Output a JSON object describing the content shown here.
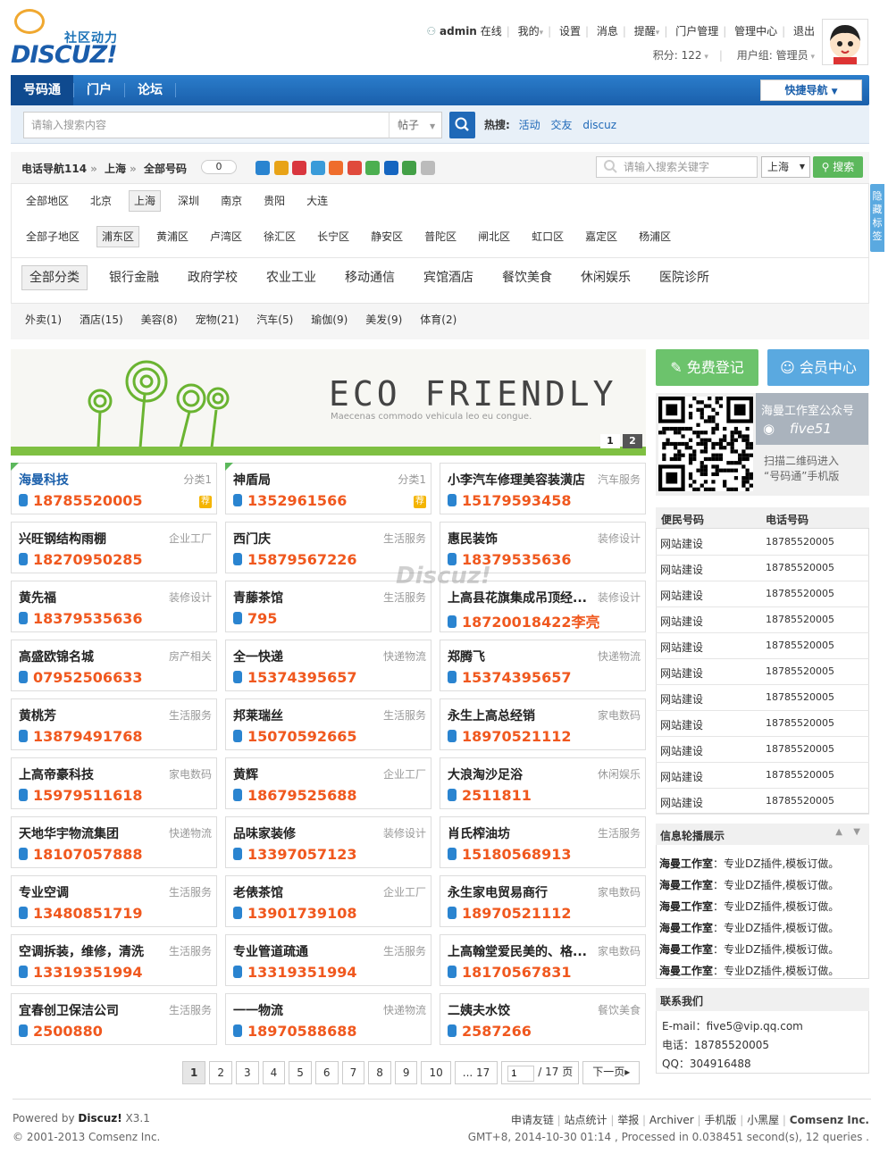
{
  "logo": {
    "sub": "社区动力",
    "big": "DISCUZ!"
  },
  "topbar": {
    "user": "admin",
    "online": "在线",
    "links": [
      "我的",
      "设置",
      "消息",
      "提醒",
      "门户管理",
      "管理中心",
      "退出"
    ],
    "points": "积分: 122",
    "group": "用户组: 管理员"
  },
  "nav": {
    "items": [
      "号码通",
      "门户",
      "论坛"
    ],
    "quick": "快捷导航"
  },
  "search": {
    "placeholder": "请输入搜索内容",
    "type": "帖子",
    "hot_label": "热搜:",
    "hot": [
      "活动",
      "交友",
      "discuz"
    ]
  },
  "crumb": {
    "a": "电话导航114",
    "b": "上海",
    "c": "全部号码",
    "count": "0"
  },
  "share_colors": [
    "#2a84d0",
    "#e8a317",
    "#d9363e",
    "#3a9bd9",
    "#ef6d2c",
    "#e04a3c",
    "#4caf50",
    "#1565c0",
    "#43a047",
    "#bbb"
  ],
  "keyword": {
    "placeholder": "请输入搜索关键字",
    "city": "上海",
    "btn": "搜索"
  },
  "regions": [
    "全部地区",
    "北京",
    "上海",
    "深圳",
    "南京",
    "贵阳",
    "大连"
  ],
  "districts": [
    "全部子地区",
    "浦东区",
    "黄浦区",
    "卢湾区",
    "徐汇区",
    "长宁区",
    "静安区",
    "普陀区",
    "闸北区",
    "虹口区",
    "嘉定区",
    "杨浦区"
  ],
  "categories": [
    "全部分类",
    "银行金融",
    "政府学校",
    "农业工业",
    "移动通信",
    "宾馆酒店",
    "餐饮美食",
    "休闲娱乐",
    "医院诊所"
  ],
  "subcats": [
    "外卖(1)",
    "酒店(15)",
    "美容(8)",
    "宠物(21)",
    "汽车(5)",
    "瑜伽(9)",
    "美发(9)",
    "体育(2)"
  ],
  "banner": {
    "title": "ECO FRIENDLY",
    "tagline": "Maecenas commodo vehicula leo eu congue.",
    "pages": [
      "1",
      "2"
    ]
  },
  "cards": [
    {
      "name": "海曼科技",
      "cat": "分类1",
      "phone": "18785520005",
      "rec": "荐"
    },
    {
      "name": "神盾局",
      "cat": "分类1",
      "phone": "1352961566",
      "rec": "荐"
    },
    {
      "name": "小李汽车修理美容装潢店",
      "cat": "汽车服务",
      "phone": "15179593458"
    },
    {
      "name": "兴旺钢结构雨棚",
      "cat": "企业工厂",
      "phone": "18270950285"
    },
    {
      "name": "西门庆",
      "cat": "生活服务",
      "phone": "15879567226"
    },
    {
      "name": "惠民装饰",
      "cat": "装修设计",
      "phone": "18379535636"
    },
    {
      "name": "黄先福",
      "cat": "装修设计",
      "phone": "18379535636"
    },
    {
      "name": "青藤茶馆",
      "cat": "生活服务",
      "phone": "795"
    },
    {
      "name": "上高县花旗集成吊顶经...",
      "cat": "装修设计",
      "phone": "18720018422李亮"
    },
    {
      "name": "高盛欧锦名城",
      "cat": "房产相关",
      "phone": "07952506633"
    },
    {
      "name": "全一快递",
      "cat": "快递物流",
      "phone": "15374395657"
    },
    {
      "name": "郑腾飞",
      "cat": "快递物流",
      "phone": "15374395657"
    },
    {
      "name": "黄桃芳",
      "cat": "生活服务",
      "phone": "13879491768"
    },
    {
      "name": "邦莱瑞丝",
      "cat": "生活服务",
      "phone": "15070592665"
    },
    {
      "name": "永生上高总经销",
      "cat": "家电数码",
      "phone": "18970521112"
    },
    {
      "name": "上高帝豪科技",
      "cat": "家电数码",
      "phone": "15979511618"
    },
    {
      "name": "黄辉",
      "cat": "企业工厂",
      "phone": "18679525688"
    },
    {
      "name": "大浪淘沙足浴",
      "cat": "休闲娱乐",
      "phone": "2511811"
    },
    {
      "name": "天地华宇物流集团",
      "cat": "快递物流",
      "phone": "18107057888"
    },
    {
      "name": "品味家装修",
      "cat": "装修设计",
      "phone": "13397057123"
    },
    {
      "name": "肖氏榨油坊",
      "cat": "生活服务",
      "phone": "15180568913"
    },
    {
      "name": "专业空调",
      "cat": "生活服务",
      "phone": "13480851719"
    },
    {
      "name": "老俵茶馆",
      "cat": "企业工厂",
      "phone": "13901739108"
    },
    {
      "name": "永生家电贸易商行",
      "cat": "家电数码",
      "phone": "18970521112"
    },
    {
      "name": "空调拆装，维修，清洗",
      "cat": "生活服务",
      "phone": "13319351994"
    },
    {
      "name": "专业管道疏通",
      "cat": "生活服务",
      "phone": "13319351994"
    },
    {
      "name": "上高翰堂爱民美的、格...",
      "cat": "家电数码",
      "phone": "18170567831"
    },
    {
      "name": "宜春创卫保洁公司",
      "cat": "生活服务",
      "phone": "2500880"
    },
    {
      "name": "一一物流",
      "cat": "快递物流",
      "phone": "18970588688"
    },
    {
      "name": "二姨夫水饺",
      "cat": "餐饮美食",
      "phone": "2587266"
    }
  ],
  "pager": {
    "pages": [
      "1",
      "2",
      "3",
      "4",
      "5",
      "6",
      "7",
      "8",
      "9",
      "10",
      "... 17"
    ],
    "input": "1",
    "total": "/ 17 页",
    "next": "下一页"
  },
  "right": {
    "reg": "免费登记",
    "vip": "会员中心",
    "qr_title": "海曼工作室公众号",
    "qr_name": "five51",
    "qr_tip1": "扫描二维码进入",
    "qr_tip2": "“号码通”手机版",
    "table_head": [
      "便民号码",
      "电话号码"
    ],
    "table_rows": [
      [
        "网站建设",
        "18785520005"
      ],
      [
        "网站建设",
        "18785520005"
      ],
      [
        "网站建设",
        "18785520005"
      ],
      [
        "网站建设",
        "18785520005"
      ],
      [
        "网站建设",
        "18785520005"
      ],
      [
        "网站建设",
        "18785520005"
      ],
      [
        "网站建设",
        "18785520005"
      ],
      [
        "网站建设",
        "18785520005"
      ],
      [
        "网站建设",
        "18785520005"
      ],
      [
        "网站建设",
        "18785520005"
      ],
      [
        "网站建设",
        "18785520005"
      ]
    ],
    "roll_head": "信息轮播展示",
    "roll": [
      {
        "who": "海曼工作室",
        "text": "：专业DZ插件,模板订做。"
      },
      {
        "who": "海曼工作室",
        "text": "：专业DZ插件,模板订做。"
      },
      {
        "who": "海曼工作室",
        "text": "：专业DZ插件,模板订做。"
      },
      {
        "who": "海曼工作室",
        "text": "：专业DZ插件,模板订做。"
      },
      {
        "who": "海曼工作室",
        "text": "：专业DZ插件,模板订做。"
      },
      {
        "who": "海曼工作室",
        "text": "：专业DZ插件,模板订做。"
      }
    ],
    "contact_head": "联系我们",
    "contact": [
      "E-mail：five5@vip.qq.com",
      "电话：18785520005",
      "QQ：304916488"
    ]
  },
  "side_tab": "隐藏标签",
  "watermark": "Discuz!",
  "footer": {
    "powered_pre": "Powered by ",
    "powered_b": "Discuz!",
    "powered_ver": " X3.1",
    "copy": "© 2001-2013 Comsenz Inc.",
    "links": [
      "申请友链",
      "站点统计",
      "举报",
      "Archiver",
      "手机版",
      "小黑屋"
    ],
    "company": "Comsenz Inc.",
    "stats": "GMT+8, 2014-10-30 01:14 , Processed in 0.038451 second(s), 12 queries ."
  }
}
